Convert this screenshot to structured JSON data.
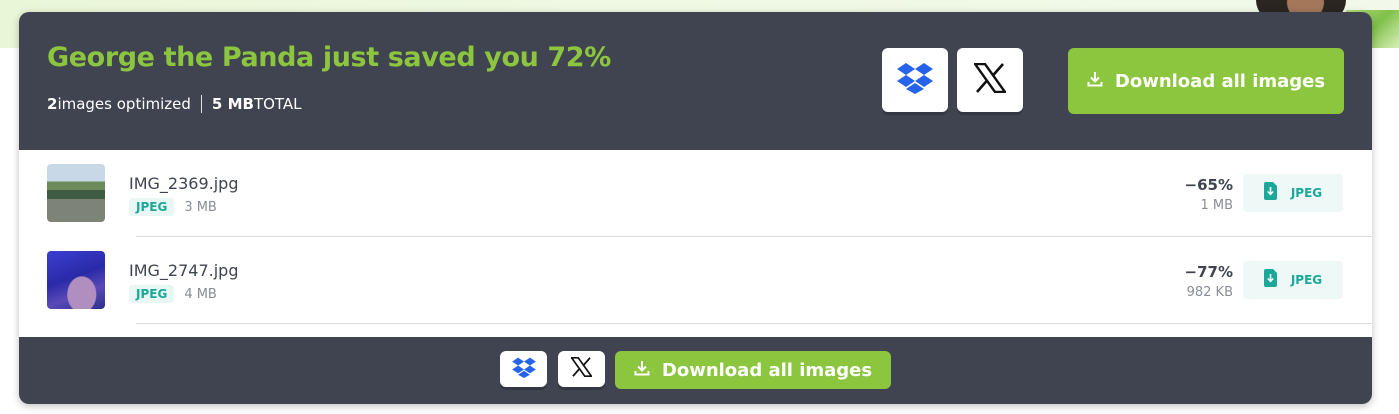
{
  "summary": {
    "headline": "George the Panda just saved you 72%",
    "images_count": "2",
    "images_label": "images optimized",
    "total_size": "5 MB",
    "total_label": "TOTAL"
  },
  "actions": {
    "download_all_label": "Download all images",
    "dropbox_icon": "dropbox-icon",
    "x_icon": "x-logo-icon",
    "download_icon": "download-icon"
  },
  "files": [
    {
      "name": "IMG_2369.jpg",
      "format": "JPEG",
      "original_size": "3 MB",
      "savings": "−65%",
      "new_size": "1 MB",
      "download_label": "JPEG"
    },
    {
      "name": "IMG_2747.jpg",
      "format": "JPEG",
      "original_size": "4 MB",
      "savings": "−77%",
      "new_size": "982 KB",
      "download_label": "JPEG"
    }
  ],
  "colors": {
    "accent": "#8cc63f",
    "header_bg": "#404450",
    "badge_text": "#1aa89a",
    "badge_bg": "#e8f6f4"
  }
}
